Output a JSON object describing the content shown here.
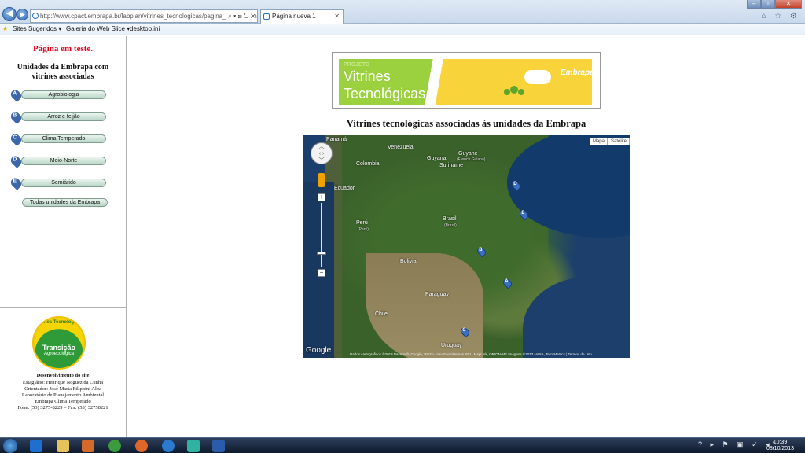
{
  "browser": {
    "address": "http://www.cpact.embrapa.br/labplan/vitrines_tecnologicas/pagina_inicial/vitrine",
    "address_tools": "⌕ ▾ ⊠ ↻ ✕",
    "tab_title": "Página nueva 1",
    "tab_close": "✕",
    "back_glyph": "◀",
    "forward_glyph": "▶",
    "window_controls": [
      "–",
      "▫",
      "✕"
    ],
    "right_icons": "⌂ ☆ ⚙"
  },
  "favorites": {
    "items": [
      "Sites Sugeridos ▾",
      "Galeria do Web Slice ▾",
      "desktop.ini"
    ]
  },
  "sidebar": {
    "test_heading": "Página em teste.",
    "units_heading": "Unidades da Embrapa com vitrines associadas",
    "units": [
      {
        "letter": "A",
        "label": "Agrobiologia"
      },
      {
        "letter": "B",
        "label": "Arroz e feijão"
      },
      {
        "letter": "C",
        "label": "Clima Temperado"
      },
      {
        "letter": "D",
        "label": "Meio-Norte"
      },
      {
        "letter": "E",
        "label": "Semiárido"
      }
    ],
    "all_units_label": "Todas unidades da Embrapa",
    "logo": {
      "arc_text": "Vitrines Tecnológicas",
      "line1": "Transição",
      "line2": "Agroecológica"
    },
    "credits": {
      "title": "Desenvolvimento do site",
      "lines": [
        "Estagiário: Henrique Noguez da Cunha",
        "Orientador: José Maria Filippini Alba",
        "Laboratório de Planejamento Ambiental",
        "Embrapa Clima Temperado",
        "Fone: (53) 3275-8229 – Fax: (53) 32758221"
      ]
    }
  },
  "main": {
    "banner": {
      "projeto": "PROJETO",
      "title_line1": "Vitrines",
      "title_line2": "Tecnológicas",
      "brand": "Embrapa"
    },
    "title": "Vitrines tecnológicas associadas às unidades da Embrapa",
    "map": {
      "type_buttons": [
        "Mapa",
        "Satélite"
      ],
      "labels": [
        "Panamá",
        "Venezuela",
        "Guyane",
        "Suriname",
        "Guyana",
        "Colombia",
        "Ecuador",
        "Brasil",
        "Perú",
        "Bolivia",
        "Paraguay",
        "Chile",
        "Uruguay"
      ],
      "sublabels": [
        "(Brasil)",
        "(Perú)",
        "(French Guiana)"
      ],
      "pins": [
        "A",
        "B",
        "C",
        "D",
        "E"
      ],
      "google": "Google",
      "attribution": "Dados cartográficos ©2013 Basarsoft, Google, INEGI, Inav/Geosistemas SRL, MapLink, ORION-ME Imagens ©2013 NASA, TerraMetrics | Termos de Uso"
    }
  },
  "taskbar": {
    "time": "10:39",
    "date": "08/10/2013",
    "tray": "?  ▸ ⚑ ▣ ✓ ◂)"
  }
}
